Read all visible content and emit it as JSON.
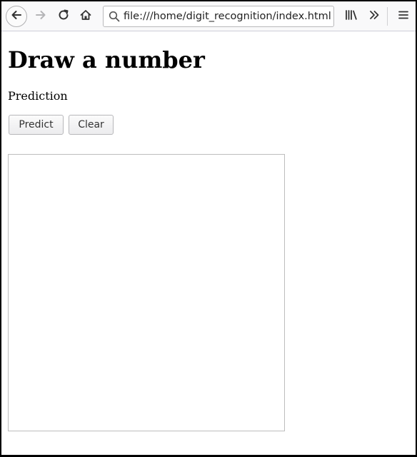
{
  "browser": {
    "url": "file:///home/digit_recognition/index.html",
    "icons": {
      "back": "back-arrow-icon",
      "forward": "forward-arrow-icon",
      "reload": "reload-icon",
      "home": "home-icon",
      "url_search": "magnifier-icon",
      "library": "library-icon",
      "overflow": "double-chevron-icon",
      "menu": "hamburger-menu-icon"
    }
  },
  "page": {
    "title": "Draw a number",
    "prediction_label": "Prediction",
    "buttons": {
      "predict": "Predict",
      "clear": "Clear"
    }
  }
}
